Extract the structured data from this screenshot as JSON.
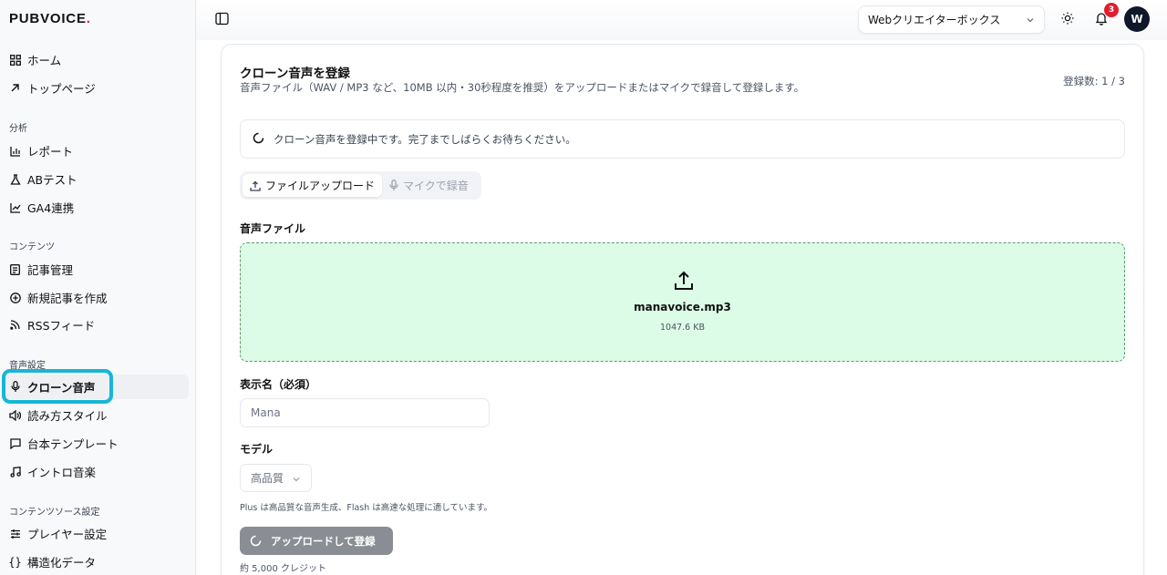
{
  "brand": {
    "name": "PUBVOICE",
    "dot": "."
  },
  "sidebar": {
    "top_items": [
      {
        "label": "ホーム",
        "icon": "grid-icon"
      },
      {
        "label": "トップページ",
        "icon": "arrow-up-right-icon"
      }
    ],
    "sections": [
      {
        "title": "分析",
        "items": [
          {
            "label": "レポート",
            "icon": "bar-chart-icon"
          },
          {
            "label": "ABテスト",
            "icon": "flask-icon"
          },
          {
            "label": "GA4連携",
            "icon": "line-chart-icon"
          }
        ]
      },
      {
        "title": "コンテンツ",
        "items": [
          {
            "label": "記事管理",
            "icon": "document-icon"
          },
          {
            "label": "新規記事を作成",
            "icon": "plus-circle-icon"
          },
          {
            "label": "RSSフィード",
            "icon": "rss-icon"
          }
        ]
      },
      {
        "title": "音声設定",
        "items": [
          {
            "label": "クローン音声",
            "icon": "microphone-icon",
            "active": true
          },
          {
            "label": "読み方スタイル",
            "icon": "speaker-icon"
          },
          {
            "label": "台本テンプレート",
            "icon": "message-square-icon"
          },
          {
            "label": "イントロ音楽",
            "icon": "music-note-icon"
          }
        ]
      },
      {
        "title": "コンテンツソース設定",
        "items": [
          {
            "label": "プレイヤー設定",
            "icon": "sliders-icon"
          },
          {
            "label": "構造化データ",
            "icon": "braces-icon"
          }
        ]
      }
    ]
  },
  "header": {
    "workspace": "Webクリエイターボックス",
    "notification_count": "3",
    "avatar_initial": "W"
  },
  "card": {
    "title": "クローン音声を登録",
    "description": "音声ファイル（WAV / MP3 など、10MB 以内・30秒程度を推奨）をアップロードまたはマイクで録音して登録します。",
    "count": "登録数: 1 / 3",
    "status_message": "クローン音声を登録中です。完了までしばらくお待ちください。",
    "tabs": [
      {
        "label": "ファイルアップロード",
        "icon": "upload-icon",
        "active": true
      },
      {
        "label": "マイクで録音",
        "icon": "microphone-icon",
        "active": false
      }
    ],
    "file_label": "音声ファイル",
    "file": {
      "name": "manavoice.mp3",
      "size": "1047.6 KB"
    },
    "display_name_label": "表示名（必須）",
    "display_name_value": "Mana",
    "model_label": "モデル",
    "model_value": "高品質",
    "model_hint": "Plus は高品質な音声生成、Flash は高速な処理に適しています。",
    "submit_label": "アップロードして登録",
    "credits": "約 5,000 クレジット"
  },
  "colors": {
    "accent_ring": "#17b6d6",
    "dropzone_bg": "#dcfce7",
    "badge": "#e11d2e"
  }
}
